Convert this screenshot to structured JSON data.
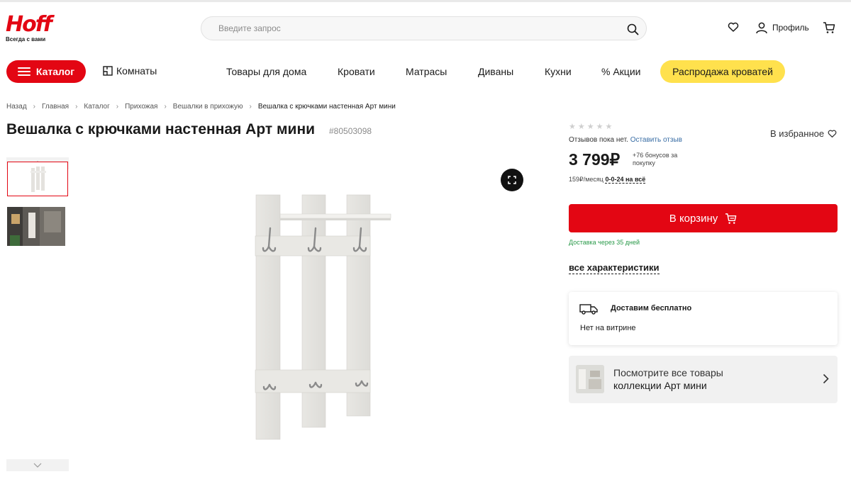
{
  "header": {
    "logo_text": "Hoff",
    "tagline": "Всегда с вами",
    "search_placeholder": "Введите запрос",
    "profile_label": "Профиль"
  },
  "nav": {
    "catalog_label": "Каталог",
    "rooms_label": "Комнаты",
    "items": [
      "Товары для дома",
      "Кровати",
      "Матрасы",
      "Диваны",
      "Кухни"
    ],
    "promo_label": "% Акции",
    "sale_label": "Распродажа кроватей"
  },
  "breadcrumb": [
    "Назад",
    "Главная",
    "Каталог",
    "Прихожая",
    "Вешалки в прихожую",
    "Вешалка с крючками настенная Арт мини"
  ],
  "product": {
    "title": "Вешалка с крючками настенная Арт мини",
    "sku": "#80503098",
    "stars": "★★★★★",
    "reviews_text": "Отзывов пока нет.",
    "leave_review": "Оставить отзыв",
    "favorites_label": "В избранное",
    "price": "3 799₽",
    "bonus_text": "+76 бонусов за покупку",
    "monthly_text": "159₽/месяц",
    "installment": "0-0-24 на всё",
    "cart_label": "В корзину",
    "delivery_note": "Доставка через 35 дней",
    "all_specs": "все характеристики"
  },
  "shipping": {
    "free_label": "Доставим бесплатно",
    "showcase": "Нет на витрине"
  },
  "collection": {
    "line1": "Посмотрите все товары",
    "line2": "коллекции Арт мини"
  },
  "colors": {
    "brand_red": "#e30613",
    "sale_yellow": "#ffe14d",
    "delivery_green": "#2a9a4a"
  }
}
